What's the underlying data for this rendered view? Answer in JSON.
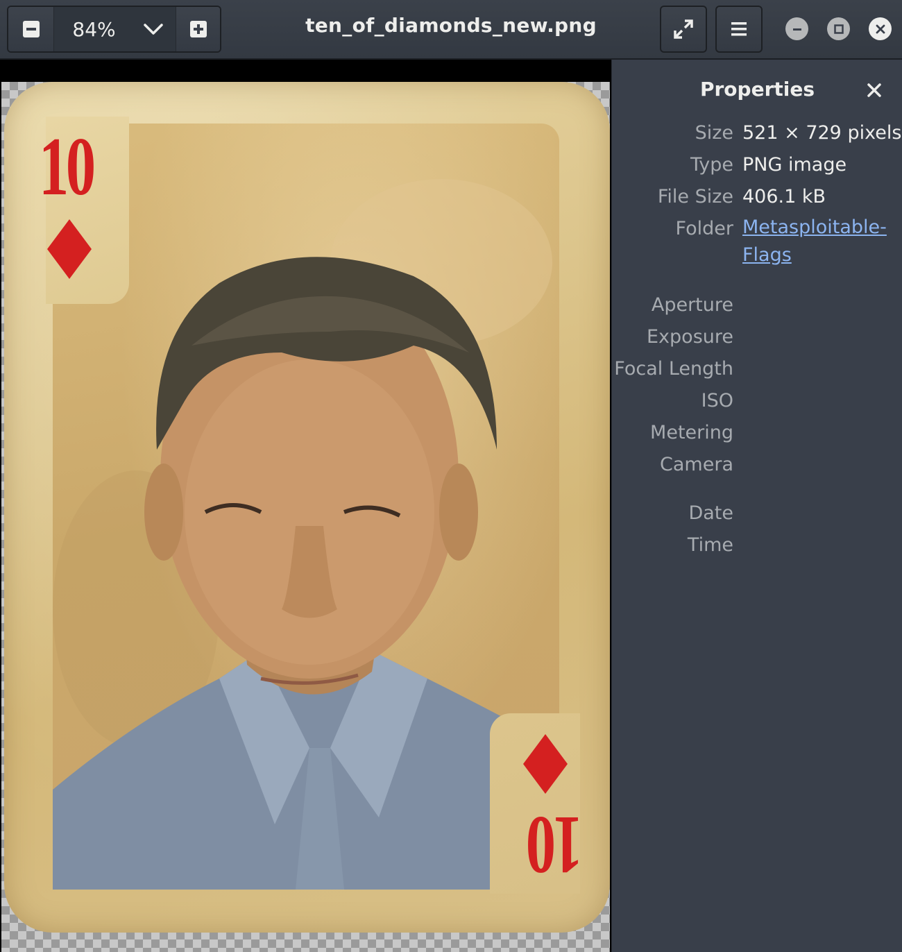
{
  "header": {
    "zoom_value": "84%",
    "title": "ten_of_diamonds_new.png"
  },
  "image": {
    "card_rank": "10",
    "card_suit": "diamonds",
    "suit_color": "#d42020"
  },
  "properties": {
    "title": "Properties",
    "size_label": "Size",
    "size_value": "521 × 729 pixels",
    "type_label": "Type",
    "type_value": "PNG image",
    "filesize_label": "File Size",
    "filesize_value": "406.1 kB",
    "folder_label": "Folder",
    "folder_value_line1": "Metasploitable-",
    "folder_value_line2": "Flags",
    "aperture_label": "Aperture",
    "exposure_label": "Exposure",
    "focal_length_label": "Focal Length",
    "iso_label": "ISO",
    "metering_label": "Metering",
    "camera_label": "Camera",
    "date_label": "Date",
    "time_label": "Time"
  },
  "colors": {
    "headerbar": "#363c45",
    "sidebar": "#393f4a",
    "link": "#8cb4f0"
  }
}
